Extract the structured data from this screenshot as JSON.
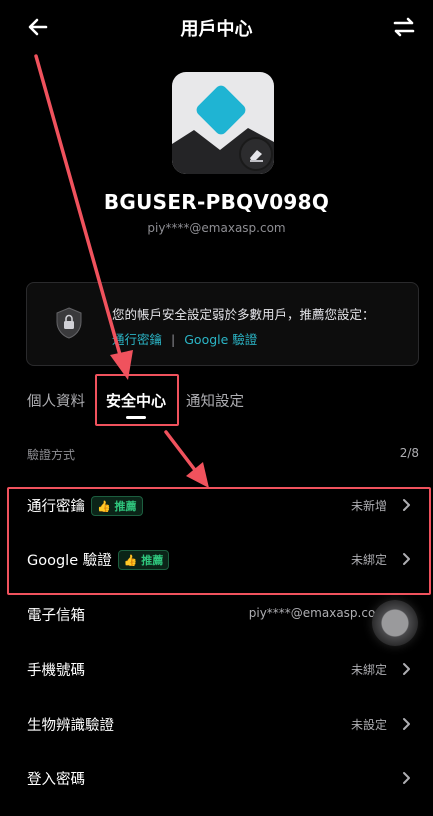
{
  "header": {
    "title": "用戶中心",
    "back_icon": "arrow-left-icon",
    "switch_icon": "switch-arrows-icon"
  },
  "profile": {
    "username": "BGUSER-PBQV098Q",
    "email": "piy****@emaxasp.com",
    "avatar_icon": "avatar-image",
    "edit_icon": "eraser-icon"
  },
  "warning": {
    "icon": "shield-lock-icon",
    "message": "您的帳戶安全設定弱於多數用戶，推薦您設定：",
    "link_passkey": "通行密鑰",
    "separator": "|",
    "link_google": "Google 驗證"
  },
  "tabs": [
    {
      "label": "個人資料",
      "active": false
    },
    {
      "label": "安全中心",
      "active": true
    },
    {
      "label": "通知設定",
      "active": false
    }
  ],
  "section": {
    "label": "驗證方式",
    "count": "2/8"
  },
  "rows": [
    {
      "label": "通行密鑰",
      "badge": "推薦",
      "value": "未新增"
    },
    {
      "label": "Google 驗證",
      "badge": "推薦",
      "value": "未綁定"
    },
    {
      "label": "電子信箱",
      "badge": "",
      "value": "piy****@emaxasp.com"
    },
    {
      "label": "手機號碼",
      "badge": "",
      "value": "未綁定"
    },
    {
      "label": "生物辨識驗證",
      "badge": "",
      "value": "未設定"
    },
    {
      "label": "登入密碼",
      "badge": "",
      "value": ""
    }
  ],
  "colors": {
    "accent_link": "#2bb5c6",
    "badge_green": "#2fc47c",
    "annotation_red": "#f0525d",
    "background": "#000000"
  }
}
